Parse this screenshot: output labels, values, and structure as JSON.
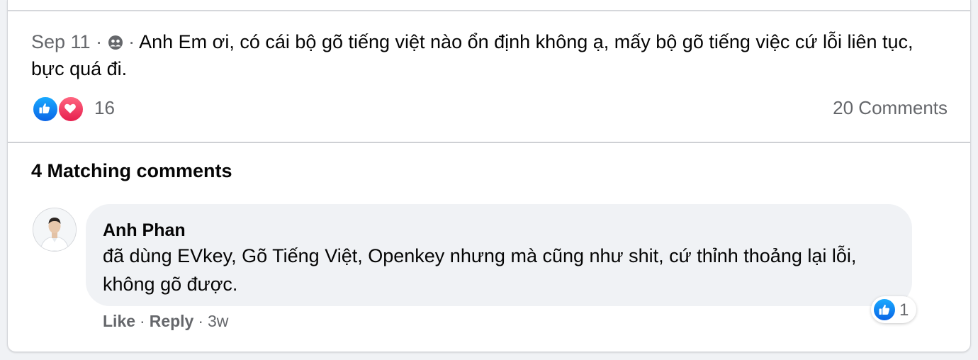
{
  "post": {
    "date": "Sep 11",
    "audience_icon": "friends-group-icon",
    "text": "Anh Em ơi, có cái bộ gõ tiếng việt nào ổn định không ạ, mấy bộ gõ tiếng việc cứ lỗi liên tục, bực quá đi.",
    "reaction_icons": [
      "like-reaction-icon",
      "love-reaction-icon"
    ],
    "reaction_count": "16",
    "comments_count": "20 Comments"
  },
  "matching": {
    "title": "4 Matching comments"
  },
  "comment": {
    "author": "Anh Phan",
    "text": "đã dùng EVkey, Gõ Tiếng Việt, Openkey nhưng mà cũng như shit, cứ thỉnh thoảng lại lỗi, không gõ được.",
    "reaction_icon": "like-reaction-icon",
    "reaction_count": "1",
    "actions": {
      "like": "Like",
      "reply": "Reply",
      "time": "3w"
    }
  },
  "colors": {
    "meta_text": "#65676b",
    "like_blue": "#0a64e6",
    "love_red": "#e61e4d",
    "bubble_bg": "#f0f2f5"
  }
}
